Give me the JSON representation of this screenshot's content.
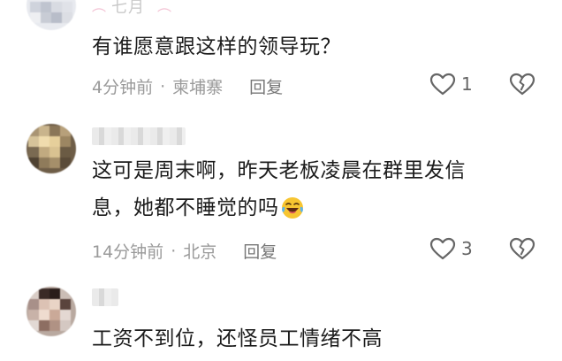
{
  "comments": [
    {
      "nickname": "七月",
      "text": "有谁愿意跟这样的领导玩？",
      "time": "4分钟前",
      "location": "柬埔寨",
      "reply_label": "回复",
      "likes": "1"
    },
    {
      "nickname": "",
      "text_line1": "这可是周末啊，昨天老板凌晨在群里发信",
      "text_line2": "息，她都不睡觉的吗",
      "time": "14分钟前",
      "location": "北京",
      "reply_label": "回复",
      "likes": "3"
    },
    {
      "nickname": "",
      "text": "工资不到位，还怪员工情绪不高"
    }
  ],
  "separator": "·",
  "icons": {
    "like": "heart-outline-icon",
    "dislike": "broken-heart-icon",
    "emoji": "laughing-crying-emoji-icon"
  },
  "colors": {
    "text": "#1c1c1c",
    "meta": "#9a9a9a",
    "icon": "#666666"
  }
}
